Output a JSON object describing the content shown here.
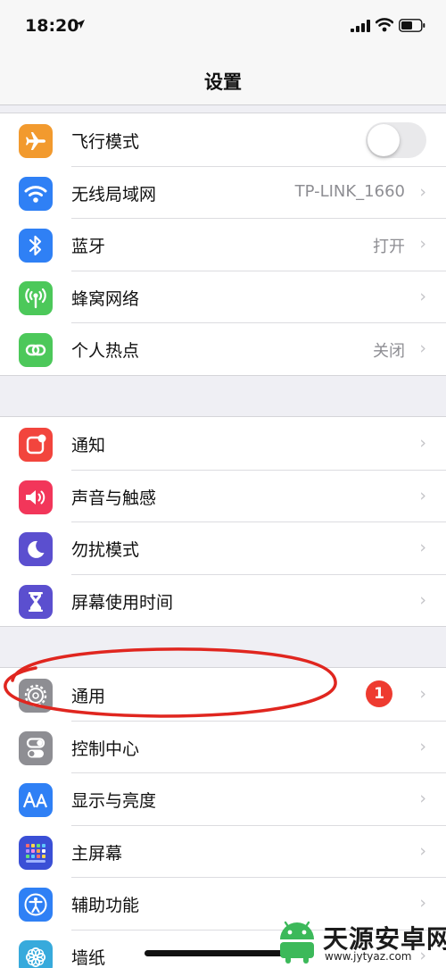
{
  "status_bar": {
    "time": "18:20"
  },
  "nav": {
    "title": "设置"
  },
  "groups": [
    {
      "items": [
        {
          "label": "飞行模式",
          "icon": "airplane-icon",
          "color": "#f29a2e",
          "toggle": false
        },
        {
          "label": "无线局域网",
          "value": "TP-LINK_1660",
          "icon": "wifi-icon",
          "color": "#2f80f5"
        },
        {
          "label": "蓝牙",
          "value": "打开",
          "icon": "bluetooth-icon",
          "color": "#2f80f5"
        },
        {
          "label": "蜂窝网络",
          "icon": "cellular-icon",
          "color": "#4cc85a"
        },
        {
          "label": "个人热点",
          "value": "关闭",
          "icon": "hotspot-icon",
          "color": "#4cc85a"
        }
      ]
    },
    {
      "items": [
        {
          "label": "通知",
          "icon": "notification-icon",
          "color": "#f2453d"
        },
        {
          "label": "声音与触感",
          "icon": "sound-icon",
          "color": "#f2365a"
        },
        {
          "label": "勿扰模式",
          "icon": "moon-icon",
          "color": "#5b4fcf"
        },
        {
          "label": "屏幕使用时间",
          "icon": "hourglass-icon",
          "color": "#5b4fcf"
        }
      ]
    },
    {
      "items": [
        {
          "label": "通用",
          "badge": "1",
          "icon": "gear-icon",
          "color": "#8e8e93"
        },
        {
          "label": "控制中心",
          "icon": "control-center-icon",
          "color": "#8e8e93"
        },
        {
          "label": "显示与亮度",
          "icon": "text-size-icon",
          "color": "#2f80f5"
        },
        {
          "label": "主屏幕",
          "icon": "home-screen-icon",
          "color": "#3a4fd6"
        },
        {
          "label": "辅助功能",
          "icon": "accessibility-icon",
          "color": "#2f80f5"
        },
        {
          "label": "墙纸",
          "icon": "wallpaper-icon",
          "color": "#37aadc"
        }
      ]
    }
  ],
  "chevron": "›",
  "annotation": {
    "color": "#e0261f"
  },
  "watermark": {
    "title": "天源安卓网",
    "url": "www.jytyaz.com"
  }
}
